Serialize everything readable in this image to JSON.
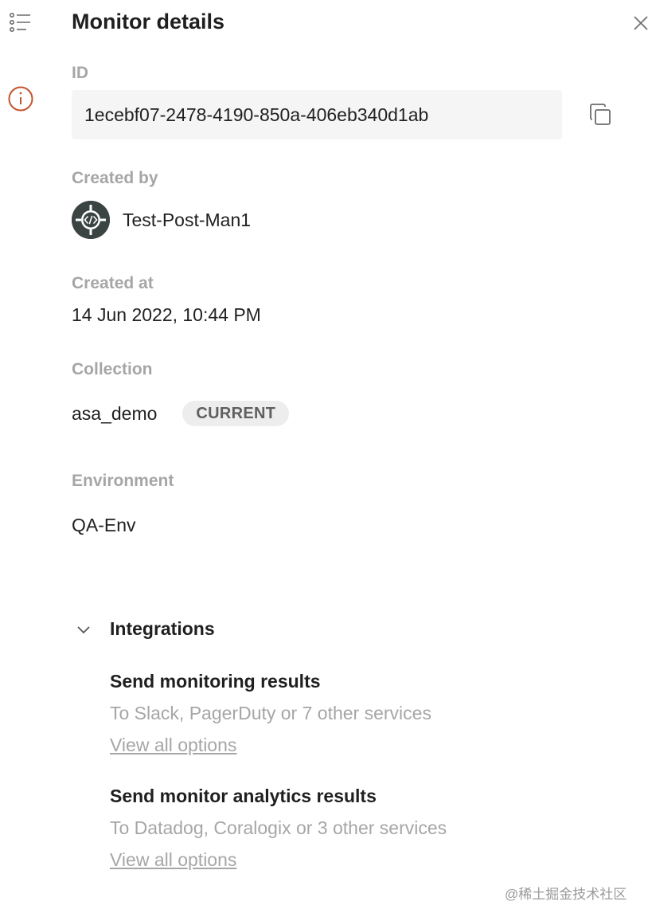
{
  "icons": {
    "rail_list": "list-icon",
    "rail_info": "info-icon",
    "close": "close-icon",
    "copy": "copy-icon",
    "avatar": "code-avatar-icon",
    "chevron": "chevron-down-icon"
  },
  "colors": {
    "info_accent": "#c2542d",
    "label_gray": "#a6a6a6",
    "badge_bg": "#ededed"
  },
  "panel": {
    "title": "Monitor details"
  },
  "id": {
    "label": "ID",
    "value": "1ecebf07-2478-4190-850a-406eb340d1ab"
  },
  "created_by": {
    "label": "Created by",
    "name": "Test-Post-Man1"
  },
  "created_at": {
    "label": "Created at",
    "value": "14 Jun 2022, 10:44 PM"
  },
  "collection": {
    "label": "Collection",
    "name": "asa_demo",
    "badge": "CURRENT"
  },
  "environment": {
    "label": "Environment",
    "value": "QA-Env"
  },
  "integrations": {
    "title": "Integrations",
    "items": [
      {
        "title": "Send monitoring results",
        "description": "To Slack, PagerDuty or 7 other services",
        "link": "View all options"
      },
      {
        "title": "Send monitor analytics results",
        "description": "To Datadog, Coralogix or 3 other services",
        "link": "View all options"
      }
    ]
  },
  "watermark": "@稀土掘金技术社区"
}
